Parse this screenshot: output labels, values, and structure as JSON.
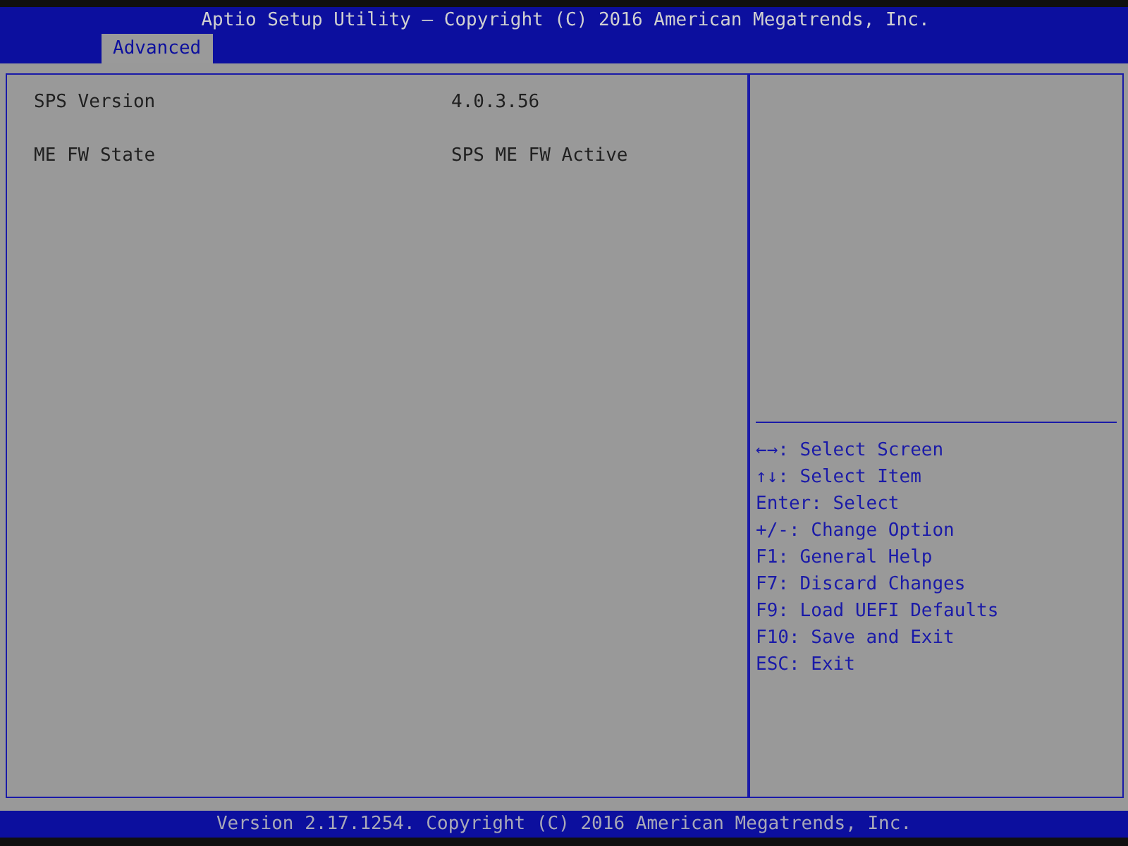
{
  "header": {
    "title": "Aptio Setup Utility – Copyright (C) 2016 American Megatrends, Inc.",
    "tabs": [
      {
        "label": "Advanced",
        "selected": true
      }
    ]
  },
  "items": [
    {
      "label": "SPS Version",
      "value": "4.0.3.56"
    },
    {
      "label": "ME FW State",
      "value": "SPS ME FW Active"
    }
  ],
  "help": [
    {
      "text": "←→: Select Screen"
    },
    {
      "text": "↑↓: Select Item"
    },
    {
      "text": "Enter: Select"
    },
    {
      "text": "+/-: Change Option"
    },
    {
      "text": "F1: General Help"
    },
    {
      "text": "F7: Discard Changes"
    },
    {
      "text": "F9: Load UEFI Defaults"
    },
    {
      "text": "F10: Save and Exit"
    },
    {
      "text": "ESC: Exit"
    }
  ],
  "footer": "Version 2.17.1254. Copyright (C) 2016 American Megatrends, Inc."
}
